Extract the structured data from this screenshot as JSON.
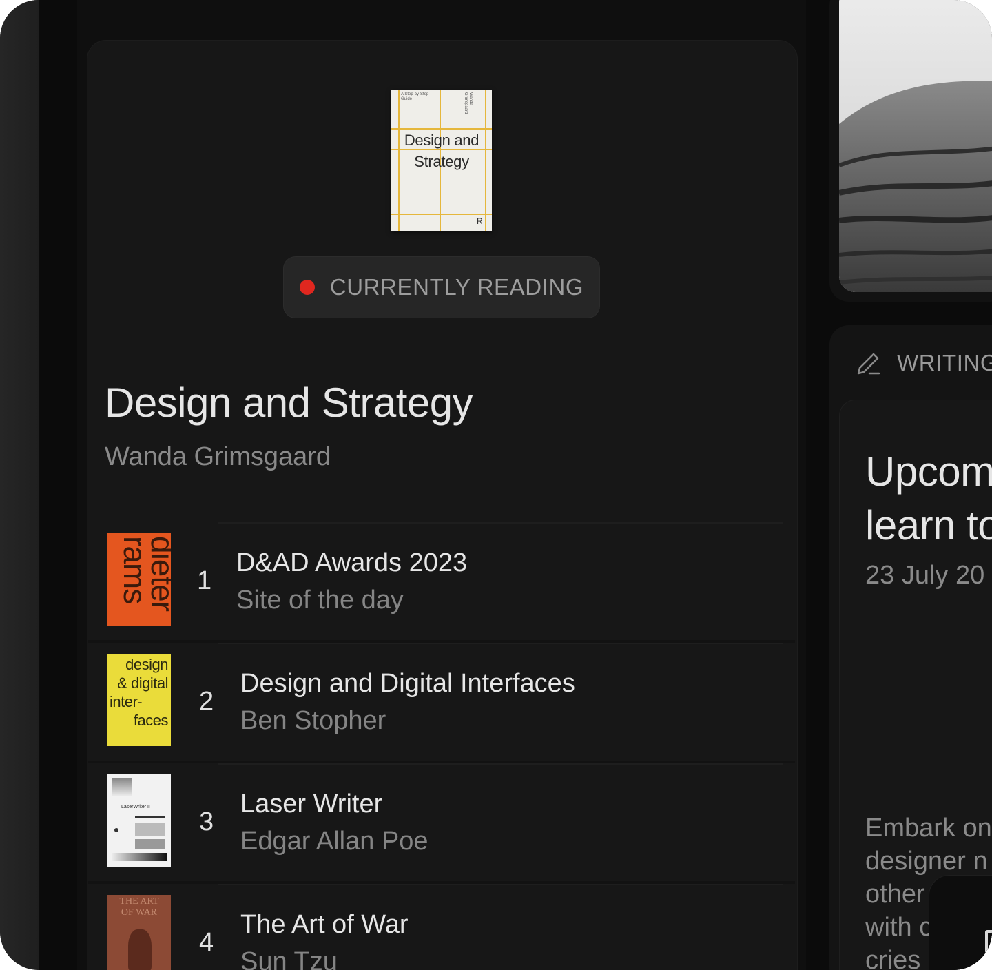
{
  "current_book": {
    "cover_title": "Design and Strategy",
    "cover_line1": "Design and",
    "cover_line2": "Strategy",
    "cover_series": "A Step-by-Step Guide",
    "cover_author_vertical": "Wanda Grimsgaard",
    "cover_publisher_mark": "R",
    "status_label": "CURRENTLY READING",
    "status_color": "#e0271f",
    "title": "Design and Strategy",
    "author": "Wanda Grimsgaard"
  },
  "reading_list": [
    {
      "rank": "1",
      "title": "D&AD Awards 2023",
      "subtitle": "Site of the day",
      "cover_text": "dieter rams",
      "cover_color": "#e4561f"
    },
    {
      "rank": "2",
      "title": "Design and Digital Interfaces",
      "subtitle": "Ben Stopher",
      "cover_lines": [
        "design",
        "& digital",
        "inter-",
        "faces"
      ],
      "cover_color": "#eadc3a"
    },
    {
      "rank": "3",
      "title": "Laser Writer",
      "subtitle": "Edgar Allan Poe",
      "cover_text": "LaserWriter II",
      "cover_color": "#f2f2f2"
    },
    {
      "rank": "4",
      "title": "The Art of War",
      "subtitle": "Sun Tzu",
      "cover_lines": [
        "THE ART",
        "OF WAR"
      ],
      "cover_color": "#8c4a35"
    }
  ],
  "writing": {
    "label": "WRITING",
    "icon": "pencil-icon",
    "post_title": "Upcom\nlearn to",
    "post_date": "23 July 20",
    "post_excerpt": "Embark on\ndesigner n\nother\nwith c\ncries"
  }
}
